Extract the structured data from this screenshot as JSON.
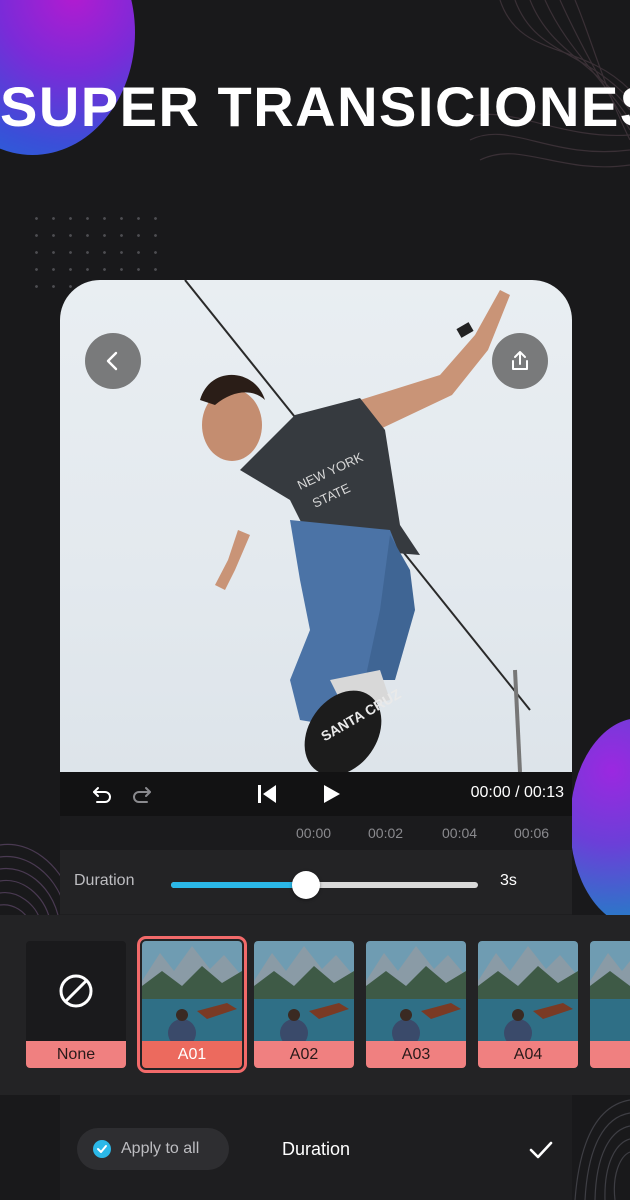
{
  "headline": "SUPER TRANSICIONES",
  "player": {
    "current_time": "00:00",
    "total_time": "00:13",
    "time_display": "00:00 / 00:13",
    "ruler_ticks": [
      "00:00",
      "00:02",
      "00:04",
      "00:06"
    ]
  },
  "duration": {
    "label": "Duration",
    "value": "3s",
    "slider_fraction": 0.44
  },
  "transitions": [
    {
      "label": "None",
      "type": "none"
    },
    {
      "label": "A01",
      "type": "thumb",
      "selected": true
    },
    {
      "label": "A02",
      "type": "thumb"
    },
    {
      "label": "A03",
      "type": "thumb"
    },
    {
      "label": "A04",
      "type": "thumb"
    }
  ],
  "bottom_bar": {
    "apply_to_all": "Apply to all",
    "title": "Duration"
  },
  "colors": {
    "accent": "#2bb8e8",
    "label_bg": "#f08080",
    "selected_outline": "#f26a6a"
  },
  "icons": [
    "back-icon",
    "share-icon",
    "undo-icon",
    "redo-icon",
    "skip-start-icon",
    "play-icon",
    "none-icon",
    "check-icon",
    "confirm-check-icon"
  ]
}
